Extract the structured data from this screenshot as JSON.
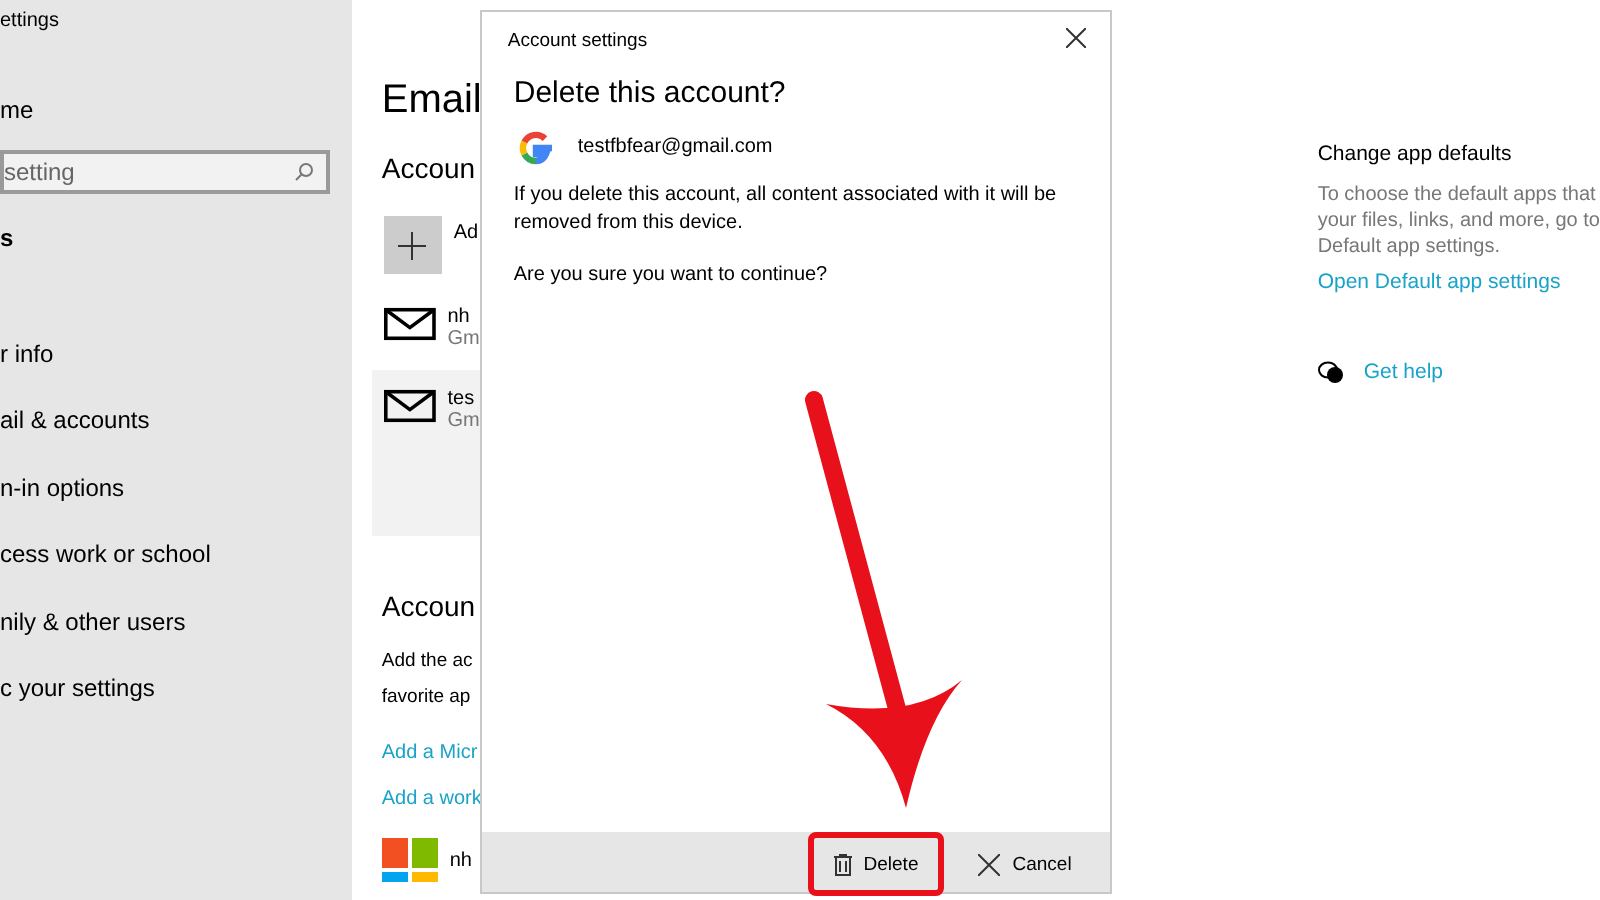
{
  "sidebar": {
    "title": "ettings",
    "home": "me",
    "search": {
      "placeholder": "setting"
    },
    "section": "s",
    "items": [
      "r info",
      "ail & accounts",
      "n-in options",
      "cess work or school",
      "nily & other users",
      "c your settings"
    ]
  },
  "main": {
    "title": "Email",
    "section_1": "Accoun",
    "add": "Ad",
    "accounts": [
      {
        "name": "nh",
        "provider": "Gm",
        "selected": false
      },
      {
        "name": "tes",
        "provider": "Gm",
        "selected": true
      }
    ],
    "section_2": "Accoun",
    "description": [
      "Add the ac",
      "favorite ap"
    ],
    "links": [
      "Add a Micr",
      "Add a work"
    ],
    "ms_account": "nh"
  },
  "dialog": {
    "title": "Account settings",
    "heading": "Delete this account?",
    "email": "testfbfear@gmail.com",
    "message": "If you delete this account, all content associated with it will be removed from this device.",
    "question": "Are you sure you want to continue?",
    "buttons": [
      {
        "label": "Delete",
        "kind": "delete",
        "highlighted": true
      },
      {
        "label": "Cancel",
        "kind": "cancel",
        "highlighted": false
      }
    ]
  },
  "right": {
    "title": "Change app defaults",
    "lines": [
      "To choose the default apps that",
      "your files, links, and more, go to",
      "Default app settings."
    ],
    "link": "Open Default app settings",
    "help": "Get help"
  }
}
